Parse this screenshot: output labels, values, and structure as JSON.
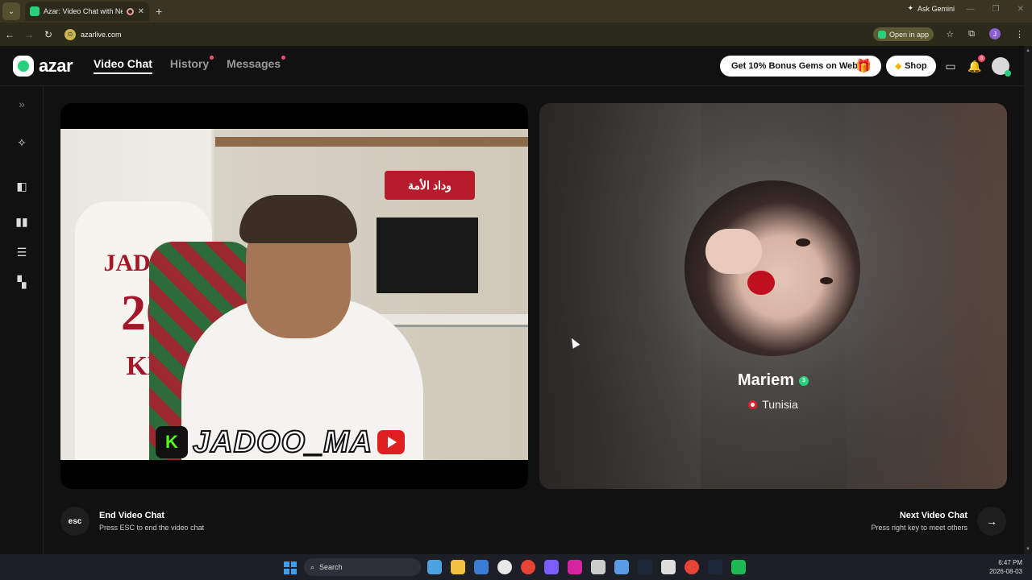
{
  "browser": {
    "tab_title": "Azar: Video Chat with New",
    "url": "azarlive.com",
    "ask_gemini": "Ask Gemini",
    "open_in_app": "Open in app",
    "profile_initial": "J"
  },
  "header": {
    "logo_text": "azar",
    "tabs": [
      {
        "label": "Video Chat",
        "active": true,
        "dot": false
      },
      {
        "label": "History",
        "active": false,
        "dot": true
      },
      {
        "label": "Messages",
        "active": false,
        "dot": true
      }
    ],
    "gems_promo": "Get 10% Bonus Gems on Web!",
    "shop_label": "Shop",
    "notification_count": "8"
  },
  "local_video": {
    "overlay_name": "JADOO_MA",
    "jersey_name": "JADOO",
    "jersey_number": "20",
    "jersey_letters": "KL",
    "flag_text": "وداد الأمة"
  },
  "partner": {
    "name": "Mariem",
    "country": "Tunisia"
  },
  "controls": {
    "esc_key": "esc",
    "end_title": "End Video Chat",
    "end_subtitle": "Press ESC to end the video chat",
    "next_title": "Next Video Chat",
    "next_subtitle": "Press right key to meet others"
  },
  "taskbar": {
    "search_label": "Search",
    "time": "6:47 PM",
    "date": "2026-08-03",
    "app_colors": [
      "#4aa3df",
      "#f0c040",
      "#3a7bd5",
      "#e8e8e8",
      "#e94335",
      "#7a5cff",
      "#d6249f",
      "#cccccc",
      "#5a9be6",
      "#1b2838",
      "#dddddd",
      "#e94335",
      "#1b2838",
      "#1db954"
    ]
  },
  "colors": {
    "accent_green": "#27d07a",
    "notification_red": "#ff4d6a"
  }
}
